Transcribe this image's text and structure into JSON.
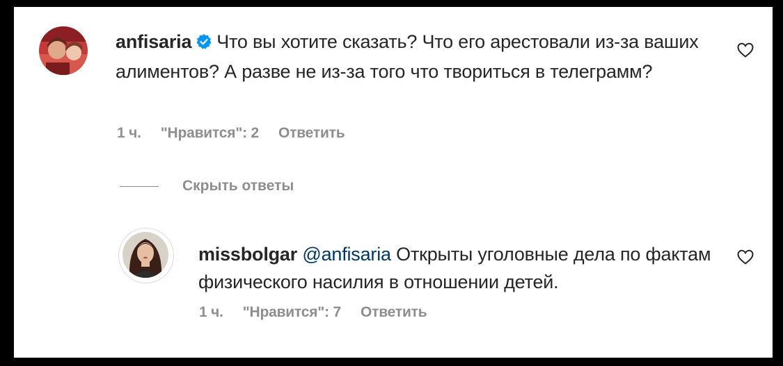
{
  "comments": [
    {
      "username": "anfisaria",
      "verified": true,
      "text": "Что вы хотите сказать? Что его арестовали из-за ваших алиментов? А разве не из-за того что твориться в телеграмм?",
      "time": "1 ч.",
      "likes": "\"Нравится\": 2",
      "reply_label": "Ответить",
      "avatar_icon": "user-avatar-photo",
      "like_icon": "heart-outline-icon"
    },
    {
      "username": "missbolgar",
      "mention": "@anfisaria",
      "text": "Открыты уголовные дела по фактам физического насилия в отношении детей.",
      "time": "1 ч.",
      "likes": "\"Нравится\": 7",
      "reply_label": "Ответить",
      "avatar_icon": "user-avatar-photo",
      "like_icon": "heart-outline-icon"
    }
  ],
  "replies_toggle": {
    "label": "Скрыть ответы"
  },
  "colors": {
    "text": "#262626",
    "secondary": "#8e8e8e",
    "link": "#00376b",
    "verified": "#0095f6"
  }
}
